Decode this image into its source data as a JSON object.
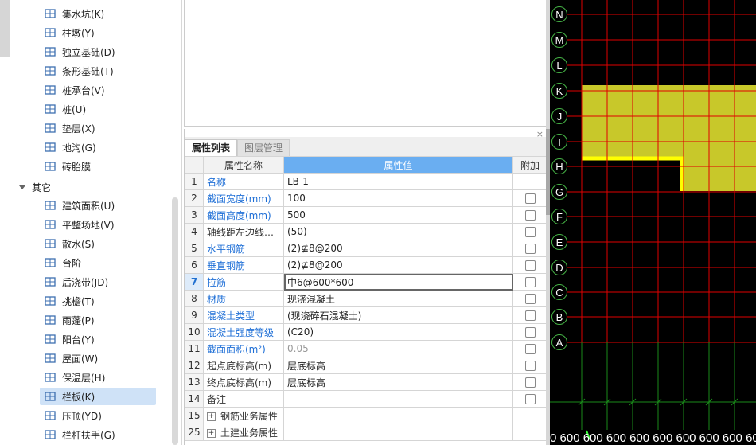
{
  "tree": {
    "items_top": [
      {
        "label": "集水坑(K)",
        "icon": "sump-pit-icon"
      },
      {
        "label": "柱墩(Y)",
        "icon": "column-pier-icon"
      },
      {
        "label": "独立基础(D)",
        "icon": "isolated-footing-icon"
      },
      {
        "label": "条形基础(T)",
        "icon": "strip-footing-icon"
      },
      {
        "label": "桩承台(V)",
        "icon": "pile-cap-icon"
      },
      {
        "label": "桩(U)",
        "icon": "pile-icon"
      },
      {
        "label": "垫层(X)",
        "icon": "cushion-icon"
      },
      {
        "label": "地沟(G)",
        "icon": "trench-icon"
      },
      {
        "label": "砖胎膜",
        "icon": "brick-mold-icon"
      }
    ],
    "group_label": "其它",
    "items_other": [
      {
        "label": "建筑面积(U)",
        "icon": "building-area-icon"
      },
      {
        "label": "平整场地(V)",
        "icon": "site-leveling-icon"
      },
      {
        "label": "散水(S)",
        "icon": "apron-icon"
      },
      {
        "label": "台阶",
        "icon": "steps-icon"
      },
      {
        "label": "后浇带(JD)",
        "icon": "post-cast-strip-icon"
      },
      {
        "label": "挑檐(T)",
        "icon": "eave-icon"
      },
      {
        "label": "雨蓬(P)",
        "icon": "canopy-icon"
      },
      {
        "label": "阳台(Y)",
        "icon": "balcony-icon"
      },
      {
        "label": "屋面(W)",
        "icon": "roof-icon"
      },
      {
        "label": "保温层(H)",
        "icon": "insulation-icon"
      },
      {
        "label": "栏板(K)",
        "icon": "parapet-icon",
        "selected": true
      },
      {
        "label": "压顶(YD)",
        "icon": "coping-icon"
      },
      {
        "label": "栏杆扶手(G)",
        "icon": "railing-icon"
      }
    ]
  },
  "panel": {
    "close": "×",
    "tab_active": "属性列表",
    "tab_inactive": "图层管理",
    "headers": {
      "name": "属性名称",
      "value": "属性值",
      "add": "附加"
    },
    "rows": [
      {
        "num": "1",
        "name": "名称",
        "value": "LB-1",
        "blue": true,
        "check": false
      },
      {
        "num": "2",
        "name": "截面宽度(mm)",
        "value": "100",
        "blue": true,
        "check": true
      },
      {
        "num": "3",
        "name": "截面高度(mm)",
        "value": "500",
        "blue": true,
        "check": true
      },
      {
        "num": "4",
        "name": "轴线距左边线距...",
        "value": "(50)",
        "blue": false,
        "check": true
      },
      {
        "num": "5",
        "name": "水平钢筋",
        "value": "(2)⊈8@200",
        "blue": true,
        "check": true
      },
      {
        "num": "6",
        "name": "垂直钢筋",
        "value": "(2)⊈8@200",
        "blue": true,
        "check": true
      },
      {
        "num": "7",
        "name": "拉筋",
        "value": "中6@600*600",
        "blue": true,
        "check": true,
        "current": true
      },
      {
        "num": "8",
        "name": "材质",
        "value": "现浇混凝土",
        "blue": true,
        "check": true
      },
      {
        "num": "9",
        "name": "混凝土类型",
        "value": "(现浇碎石混凝土)",
        "blue": true,
        "check": true
      },
      {
        "num": "10",
        "name": "混凝土强度等级",
        "value": "(C20)",
        "blue": true,
        "check": true
      },
      {
        "num": "11",
        "name": "截面面积(m²)",
        "value": "0.05",
        "blue": true,
        "check": true,
        "gray": true
      },
      {
        "num": "12",
        "name": "起点底标高(m)",
        "value": "层底标高",
        "blue": false,
        "check": true
      },
      {
        "num": "13",
        "name": "终点底标高(m)",
        "value": "层底标高",
        "blue": false,
        "check": true
      },
      {
        "num": "14",
        "name": "备注",
        "value": "",
        "blue": false,
        "check": true
      },
      {
        "num": "15",
        "name": "钢筋业务属性",
        "value": "",
        "blue": false,
        "check": false,
        "expand": true
      },
      {
        "num": "25",
        "name": "土建业务属性",
        "value": "",
        "blue": false,
        "check": false,
        "expand": true
      }
    ],
    "expand_symbol": "+"
  },
  "canvas": {
    "axes": [
      "N",
      "M",
      "L",
      "K",
      "J",
      "I",
      "H",
      "G",
      "F",
      "E",
      "D",
      "C",
      "B",
      "A"
    ],
    "dimension_text": "0 600 600 600 600 600 600 600 600 600",
    "colors": {
      "grid": "#e00000",
      "slab": "#c8c82a",
      "slab_edge": "#ffff00",
      "axis": "#46b446",
      "green_grid": "#1a8a1a"
    }
  }
}
